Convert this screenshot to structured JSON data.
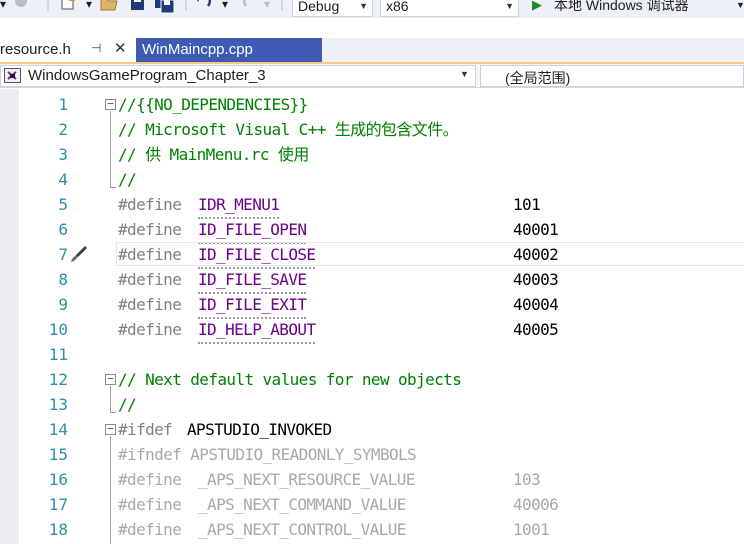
{
  "toolbar": {
    "config_value": "Debug",
    "platform_value": "x86",
    "run_label": "本地 Windows 调试器"
  },
  "tabs": {
    "active": {
      "label": "resource.h",
      "pin": "⊣",
      "close": "✕"
    },
    "inactive": {
      "label": "WinMaincpp.cpp"
    }
  },
  "nav": {
    "project": "WindowsGameProgram_Chapter_3",
    "scope": "(全局范围)"
  },
  "editor": {
    "current_line": 7,
    "lines": [
      {
        "num": "1",
        "code": "//{{NO_DEPENDENCIES}}"
      },
      {
        "num": "2",
        "code": "// Microsoft Visual C++ 生成的包含文件。"
      },
      {
        "num": "3",
        "code": "// 供 MainMenu.rc 使用"
      },
      {
        "num": "4",
        "code": "//"
      },
      {
        "num": "5",
        "directive": "#define",
        "name": "IDR_MENU1",
        "value": "101"
      },
      {
        "num": "6",
        "directive": "#define",
        "name": "ID_FILE_OPEN",
        "value": "40001"
      },
      {
        "num": "7",
        "directive": "#define",
        "name": "ID_FILE_CLOSE",
        "value": "40002"
      },
      {
        "num": "8",
        "directive": "#define",
        "name": "ID_FILE_SAVE",
        "value": "40003"
      },
      {
        "num": "9",
        "directive": "#define",
        "name": "ID_FILE_EXIT",
        "value": "40004"
      },
      {
        "num": "10",
        "directive": "#define",
        "name": "ID_HELP_ABOUT",
        "value": "40005"
      },
      {
        "num": "11",
        "code": ""
      },
      {
        "num": "12",
        "code": "// Next default values for new objects"
      },
      {
        "num": "13",
        "code": "//"
      },
      {
        "num": "14",
        "directive": "#ifdef",
        "name": "APSTUDIO_INVOKED"
      },
      {
        "num": "15",
        "code": "#ifndef APSTUDIO_READONLY_SYMBOLS"
      },
      {
        "num": "16",
        "directive": "#define",
        "name": "_APS_NEXT_RESOURCE_VALUE",
        "value": "103"
      },
      {
        "num": "17",
        "directive": "#define",
        "name": "_APS_NEXT_COMMAND_VALUE",
        "value": "40006"
      },
      {
        "num": "18",
        "directive": "#define",
        "name": "_APS_NEXT_CONTROL_VALUE",
        "value": "1001"
      }
    ]
  }
}
